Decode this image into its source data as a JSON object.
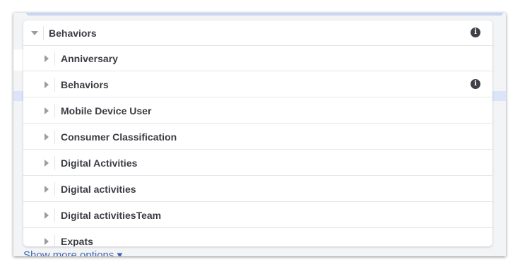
{
  "header": {
    "label": "Behaviors",
    "info_icon": "info-icon"
  },
  "items": [
    {
      "label": "Anniversary",
      "has_info": false
    },
    {
      "label": "Behaviors",
      "has_info": true
    },
    {
      "label": "Mobile Device User",
      "has_info": false
    },
    {
      "label": "Consumer Classification",
      "has_info": false
    },
    {
      "label": "Digital Activities",
      "has_info": false
    },
    {
      "label": "Digital activities",
      "has_info": false
    },
    {
      "label": "Digital activitiesTeam",
      "has_info": false
    },
    {
      "label": "Expats",
      "has_info": false
    }
  ],
  "footer": {
    "show_more": "Show more options ▾"
  },
  "colors": {
    "accent": "#4267b2",
    "text": "#3b3d43",
    "panel": "#ffffff"
  }
}
